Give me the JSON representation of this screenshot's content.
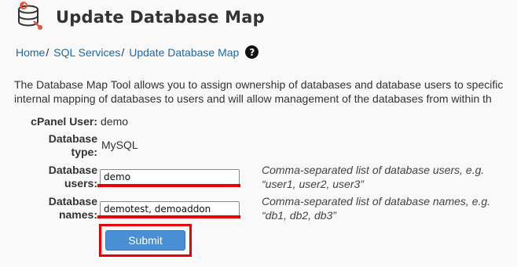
{
  "header": {
    "title": "Update Database Map",
    "icon": "database-icon",
    "icon_accent": "#e8553a"
  },
  "breadcrumb": {
    "items": [
      "Home",
      "SQL Services",
      "Update Database Map"
    ],
    "separator": "/",
    "help_icon": "question-circle-icon"
  },
  "description": {
    "line1": "The Database Map Tool allows you to assign ownership of databases and database users to specific",
    "line2": "internal mapping of databases to users and will allow management of the databases from within th"
  },
  "form": {
    "cpanel_user": {
      "label": "cPanel User:",
      "value": "demo"
    },
    "database_type": {
      "label_line1": "Database",
      "label_line2": "type:",
      "value": "MySQL"
    },
    "database_users": {
      "label_line1": "Database",
      "label_line2": "users:",
      "value": "demo",
      "hint_line1": "Comma-separated list of database users, e.g.",
      "hint_line2": "“user1, user2, user3”"
    },
    "database_names": {
      "label_line1": "Database",
      "label_line2": "names:",
      "value": "demotest, demoaddon",
      "hint_line1": "Comma-separated list of database names, e.g.",
      "hint_line2": "“db1, db2, db3”"
    },
    "submit_label": "Submit"
  },
  "colors": {
    "link": "#1b6ba8",
    "highlight": "#e8000b",
    "button": "#4a8fd4",
    "background": "#f9f9f9"
  }
}
